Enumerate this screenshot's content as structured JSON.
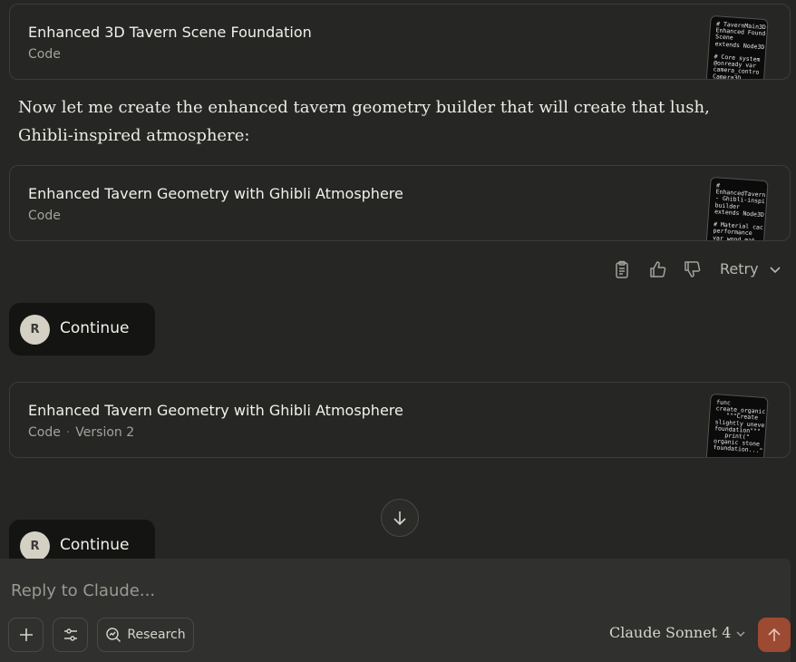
{
  "artifacts": [
    {
      "title": "Enhanced 3D Tavern Scene Foundation",
      "kind": "Code",
      "version": "",
      "preview": "# TavernMain3D\nEnhanced Found\nScene\nextends Node3D\n\n# Core system\n@onready var\ncamera_contro\nCamera3D"
    },
    {
      "title": "Enhanced Tavern Geometry with Ghibli Atmosphere",
      "kind": "Code",
      "version": "",
      "preview": "#\nEnhancedTavern\n- Ghibli-inspi\nbuilder\nextends Node3D\n\n# Material cac\nperformance\nvar wood_mat"
    },
    {
      "title": "Enhanced Tavern Geometry with Ghibli Atmosphere",
      "kind": "Code",
      "version": "Version 2",
      "preview": "func\ncreate_organic\n   \"\"\"Create\nslightly uneve\nfoundation\"\"\"\n   print(\"\norganic stone\nfoundation...\""
    }
  ],
  "assistant_text": "Now let me create the enhanced tavern geometry builder that will create that lush, Ghibli-inspired atmosphere:",
  "message_actions": {
    "icons": [
      "clipboard-icon",
      "thumbs-up-icon",
      "thumbs-down-icon"
    ],
    "retry_label": "Retry"
  },
  "user_messages": [
    {
      "avatar": "R",
      "text": "Continue"
    },
    {
      "avatar": "R",
      "text": "Continue"
    }
  ],
  "composer": {
    "placeholder": "Reply to Claude...",
    "research_label": "Research",
    "model_label": "Claude Sonnet 4"
  },
  "colors": {
    "background": "#262624",
    "composer": "#30302e",
    "user_bubble": "#141413",
    "send_button": "#9c4a32"
  }
}
